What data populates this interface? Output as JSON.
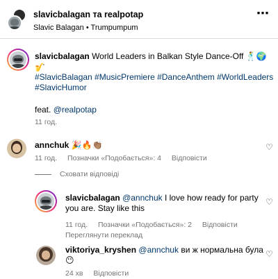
{
  "header": {
    "title": "slavicbalagan та realpotap",
    "subtitle": "Slavic Balagan • Trumpumpum",
    "more_icon": "⋯"
  },
  "caption": {
    "username": "slavicbalagan",
    "text": "World Leaders in Balkan Style Dance-Off 🕺🌍🎷",
    "hashtags_line1": "#SlavicBalagan #MusicPremiere #DanceAnthem #WorldLeaders",
    "hashtags_line2": "#SlavicHumor",
    "feat_label": "feat.",
    "feat_user": "@realpotap",
    "time": "11 год."
  },
  "comments": [
    {
      "username": "annchuk",
      "text": "🎉🔥👏🏽",
      "time": "11 год.",
      "likes": "Позначки «Подобається»: 4",
      "reply": "Відповісти"
    }
  ],
  "view_replies": "Сховати відповіді",
  "replies": [
    {
      "username": "slavicbalagan",
      "mention": "@annchuk",
      "text_line1": "I love how ready for party",
      "text_line2": "you are. Stay like this",
      "time": "11 год.",
      "likes": "Позначки «Подобається»: 2",
      "reply": "Відповісти",
      "translate": "Переглянути переклад"
    },
    {
      "username": "viktoriya_kryshen",
      "mention": "@annchuk",
      "text_line1": "ви ж нормальна була",
      "text_line2": "😶",
      "time": "24 хв",
      "reply": "Відповісти"
    }
  ],
  "icons": {
    "heart": "♡"
  }
}
